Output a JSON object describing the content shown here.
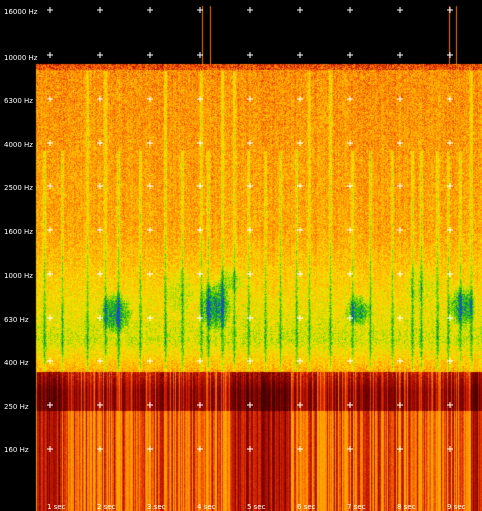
{
  "spectrogram": {
    "y_axis": {
      "unit": "Hz",
      "ticks": [
        "16000 Hz",
        "10000 Hz",
        "6300 Hz",
        "4000 Hz",
        "2500 Hz",
        "1600 Hz",
        "1000 Hz",
        "630 Hz",
        "400 Hz",
        "250 Hz",
        "160 Hz"
      ]
    },
    "x_axis": {
      "unit": "sec",
      "ticks": [
        "1 sec",
        "2 sec",
        "3 sec",
        "4 sec",
        "5 sec",
        "6 sec",
        "7 sec",
        "8 sec",
        "9 sec"
      ]
    },
    "colormap": [
      "#000000",
      "#7a0000",
      "#d42000",
      "#ff7a00",
      "#ffb400",
      "#ffe000",
      "#c8e000",
      "#4ec800",
      "#00a040",
      "#1e46c8"
    ],
    "background": "#000000"
  }
}
